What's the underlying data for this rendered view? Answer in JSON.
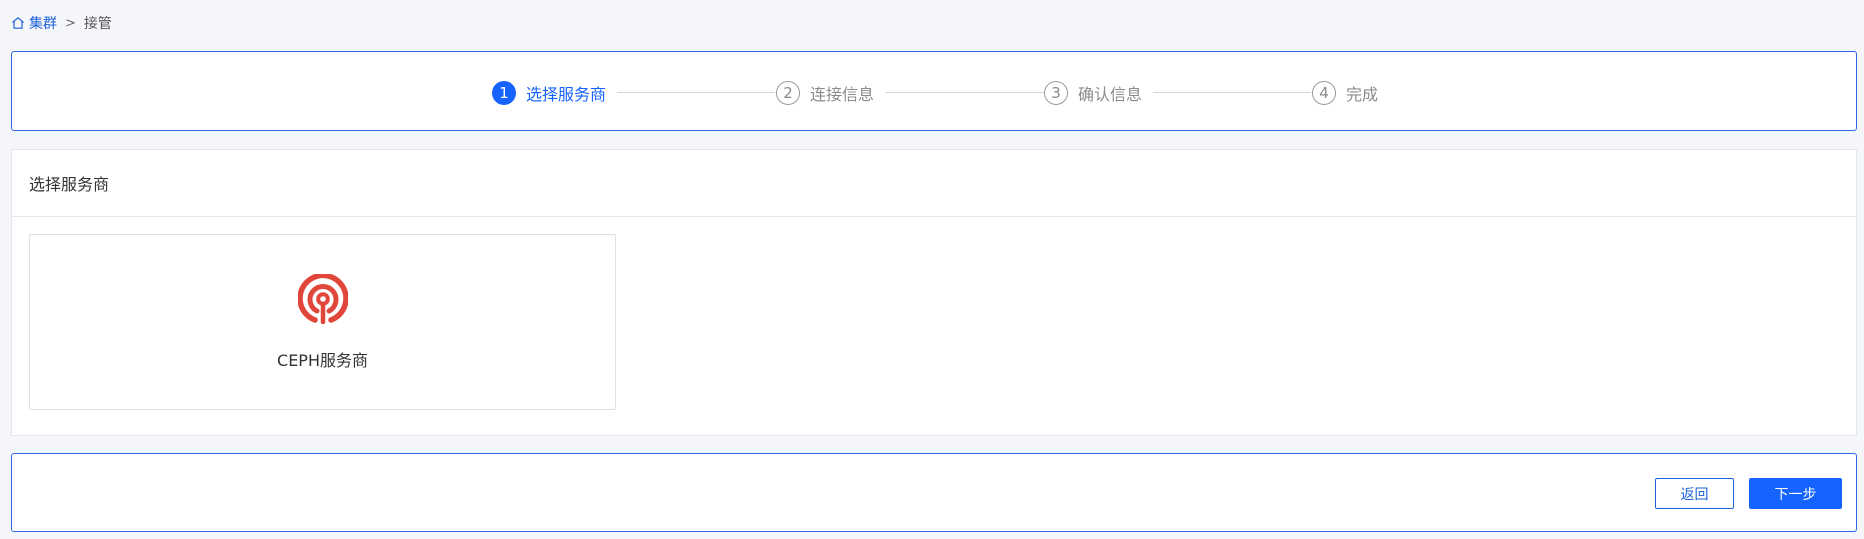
{
  "breadcrumb": {
    "home_label": "集群",
    "separator": ">",
    "current": "接管"
  },
  "steps": [
    {
      "number": "1",
      "label": "选择服务商",
      "state": "active"
    },
    {
      "number": "2",
      "label": "连接信息",
      "state": "inactive"
    },
    {
      "number": "3",
      "label": "确认信息",
      "state": "inactive"
    },
    {
      "number": "4",
      "label": "完成",
      "state": "inactive"
    }
  ],
  "provider_section": {
    "title": "选择服务商",
    "providers": [
      {
        "name": "CEPH服务商",
        "icon": "ceph-logo-icon"
      }
    ]
  },
  "footer": {
    "back_label": "返回",
    "next_label": "下一步"
  },
  "colors": {
    "primary": "#1664ff",
    "border_accent": "#2f67de",
    "ceph_red": "#e0473a"
  }
}
